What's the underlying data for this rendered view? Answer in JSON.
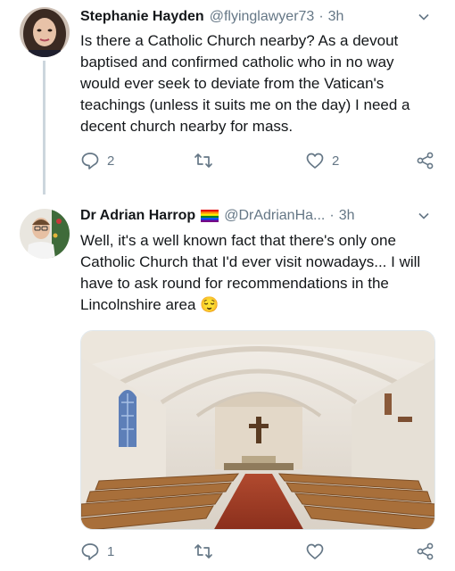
{
  "tweets": [
    {
      "name": "Stephanie Hayden",
      "handle": "@flyinglawyer73",
      "dot": "·",
      "time": "3h",
      "text": "Is there a Catholic Church nearby? As a devout baptised and confirmed catholic who in no way would ever seek to deviate from the Vatican's teachings (unless it suits me on the day) I need a decent church nearby for mass.",
      "replies": "2",
      "retweets": "",
      "likes": "2",
      "icons": {
        "reply": "reply-icon",
        "retweet": "retweet-icon",
        "like": "heart-icon",
        "share": "share-icon"
      }
    },
    {
      "name": "Dr Adrian Harrop",
      "handle": "@DrAdrianHa...",
      "dot": "·",
      "time": "3h",
      "text": "Well, it's a well known fact that there's only one Catholic Church that I'd ever visit nowadays... I will have to ask round for recommendations in the Lincolnshire area",
      "emoji": "😌",
      "replies": "1",
      "retweets": "",
      "likes": "",
      "icons": {
        "reply": "reply-icon",
        "retweet": "retweet-icon",
        "like": "heart-icon",
        "share": "share-icon"
      }
    }
  ],
  "colors": {
    "text": "#14171a",
    "secondary": "#657786",
    "thread_line": "#ccd6dd"
  }
}
